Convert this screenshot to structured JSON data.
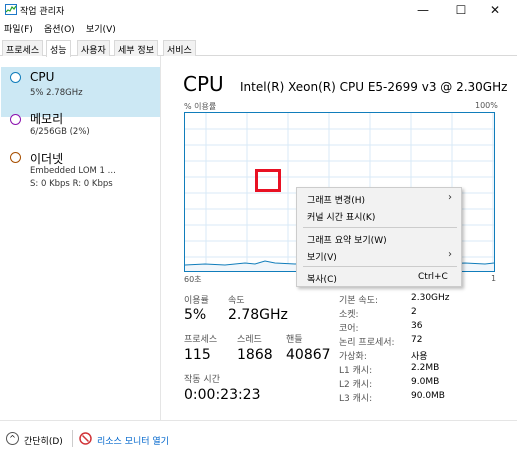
{
  "window": {
    "title": "작업 관리자",
    "min_glyph": "—",
    "max_glyph": "☐",
    "close_glyph": "✕"
  },
  "menu": {
    "file": "파일(F)",
    "options": "옵션(O)",
    "view": "보기(V)"
  },
  "tabs": [
    "프로세스",
    "성능",
    "사용자",
    "세부 정보",
    "서비스"
  ],
  "sidebar": {
    "items": [
      {
        "name": "CPU",
        "sub1": "5% 2.78GHz",
        "sub2": "",
        "color": "#117dbb"
      },
      {
        "name": "메모리",
        "sub1": "6/256GB (2%)",
        "sub2": "",
        "color": "#8b12ae"
      },
      {
        "name": "이더넷",
        "sub1": "Embedded LOM 1 ...",
        "sub2": "S: 0 Kbps R: 0 Kbps",
        "color": "#a74f01"
      }
    ]
  },
  "main": {
    "title": "CPU",
    "model": "Intel(R) Xeon(R) CPU E5-2699 v3 @ 2.30GHz",
    "graph": {
      "ylabel": "% 이용률",
      "ymax": "100%",
      "xlabel": "60초",
      "xmin": "1",
      "line_color": "#117dbb"
    },
    "stats": {
      "usage_label": "이용률",
      "usage_value": "5%",
      "speed_label": "속도",
      "speed_value": "2.78GHz",
      "processes_label": "프로세스",
      "processes_value": "115",
      "threads_label": "스레드",
      "threads_value": "1868",
      "handles_label": "핸들",
      "handles_value": "40867",
      "uptime_label": "작동 시간",
      "uptime_value": "0:00:23:23"
    },
    "details": [
      {
        "label": "기본 속도:",
        "value": "2.30GHz"
      },
      {
        "label": "소켓:",
        "value": "2"
      },
      {
        "label": "코어:",
        "value": "36"
      },
      {
        "label": "논리 프로세서:",
        "value": "72"
      },
      {
        "label": "가상화:",
        "value": "사용"
      },
      {
        "label": "L1 캐시:",
        "value": "2.2MB"
      },
      {
        "label": "L2 캐시:",
        "value": "9.0MB"
      },
      {
        "label": "L3 캐시:",
        "value": "90.0MB"
      }
    ]
  },
  "context_menu": {
    "items": [
      {
        "label": "그래프 변경(H)",
        "arrow": "›",
        "shortcut": ""
      },
      {
        "label": "커널 시간 표시(K)",
        "arrow": "",
        "shortcut": ""
      },
      {
        "label": "그래프 요약 보기(W)",
        "arrow": "",
        "shortcut": ""
      },
      {
        "label": "보기(V)",
        "arrow": "›",
        "shortcut": ""
      },
      {
        "label": "복사(C)",
        "arrow": "",
        "shortcut": "Ctrl+C"
      }
    ]
  },
  "bottom": {
    "fewer_details": "간단히(D)",
    "fewer_icon": "^",
    "resource_monitor": "리소스 모니터 열기"
  }
}
